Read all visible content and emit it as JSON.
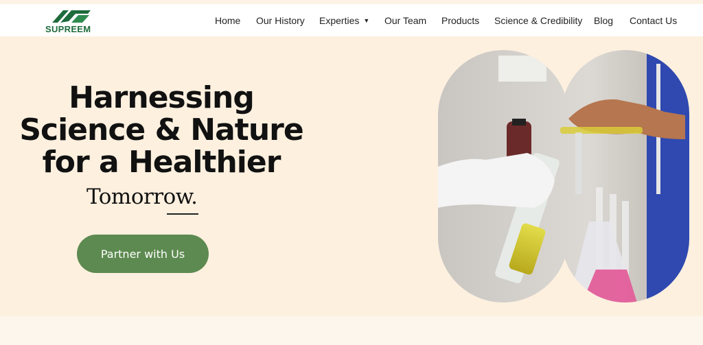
{
  "brand": {
    "name": "SUPREEM",
    "color": "#1e6b3c"
  },
  "nav": {
    "items": [
      {
        "label": "Home"
      },
      {
        "label": "Our History"
      },
      {
        "label": "Experties",
        "has_dropdown": true
      },
      {
        "label": "Our Team"
      },
      {
        "label": "Products"
      },
      {
        "label": "Science & Credibility"
      },
      {
        "label": "Blog"
      },
      {
        "label": "Contact Us"
      }
    ],
    "dropdown_icon": "chevron-down-icon"
  },
  "hero": {
    "headline_lines": [
      "Harnessing",
      "Science & Nature",
      "for a Healthier"
    ],
    "tagline": "Tomorrow.",
    "cta_label": "Partner with Us",
    "cta_color": "#5d8a50",
    "background_color": "#fdf0df",
    "image": "laboratory-scientist-photo"
  }
}
